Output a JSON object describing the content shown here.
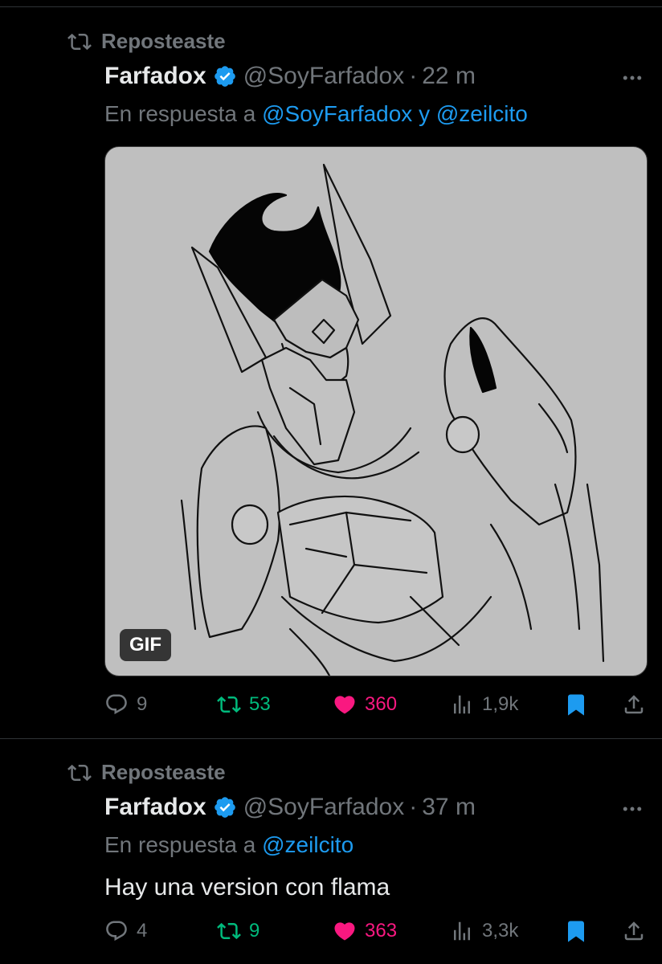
{
  "colors": {
    "background": "#000000",
    "text_primary": "#e7e9ea",
    "text_secondary": "#71767b",
    "accent_blue": "#1d9bf0",
    "repost_green": "#00ba7c",
    "like_pink": "#f91880",
    "divider": "#2f3336"
  },
  "tweets": [
    {
      "repost_label": "Reposteaste",
      "author_name": "Farfadox",
      "author_handle": "@SoyFarfadox",
      "separator": "·",
      "time": "22 m",
      "reply_prefix": "En respuesta a",
      "reply_mentions": [
        "@SoyFarfadox",
        "@zeilcito"
      ],
      "reply_joiner": "y",
      "media": {
        "type": "gif",
        "badge": "GIF",
        "description_icon": "armored-character-line-art"
      },
      "stats": {
        "replies": "9",
        "reposts": "53",
        "likes": "360",
        "views": "1,9k"
      },
      "liked": true,
      "reposted": true,
      "bookmarked": true
    },
    {
      "repost_label": "Reposteaste",
      "author_name": "Farfadox",
      "author_handle": "@SoyFarfadox",
      "separator": "·",
      "time": "37 m",
      "reply_prefix": "En respuesta a",
      "reply_mentions": [
        "@zeilcito"
      ],
      "text": "Hay una version con flama",
      "stats": {
        "replies": "4",
        "reposts": "9",
        "likes": "363",
        "views": "3,3k"
      },
      "liked": true,
      "reposted": true,
      "bookmarked": true
    }
  ],
  "icons": {
    "repost": "repost-icon",
    "verified": "verified-badge-icon",
    "more": "more-dots-icon",
    "reply": "reply-bubble-icon",
    "like": "heart-icon",
    "views": "views-bar-chart-icon",
    "bookmark": "bookmark-icon",
    "share": "share-upload-icon"
  }
}
